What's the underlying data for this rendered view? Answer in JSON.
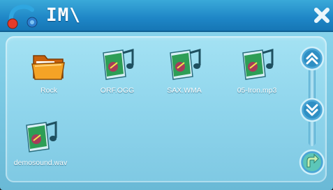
{
  "window": {
    "title": "IM\\",
    "title_icon": "folder-music-icon",
    "close_icon": "close-icon"
  },
  "files": [
    {
      "label": "Rock",
      "icon": "folder-icon"
    },
    {
      "label": "ORF.OGG",
      "icon": "music-file-icon"
    },
    {
      "label": "SAX.WMA",
      "icon": "music-file-icon"
    },
    {
      "label": "05-Iron.mp3",
      "icon": "music-file-icon"
    },
    {
      "label": "demosound.wav",
      "icon": "music-file-icon"
    }
  ],
  "controls": {
    "scroll_up_icon": "double-chevron-up-icon",
    "scroll_down_icon": "double-chevron-down-icon",
    "back_icon": "back-arrow-icon"
  },
  "colors": {
    "titlebar": "#1e86c6",
    "background": "#8fd5ec",
    "text": "#ffffff"
  }
}
